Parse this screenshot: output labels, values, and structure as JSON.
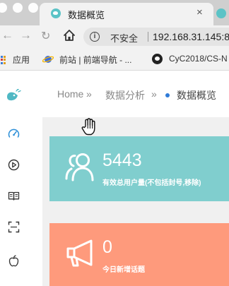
{
  "browser": {
    "tab": {
      "title": "数据概览",
      "close_glyph": "×"
    },
    "toolbar": {
      "back_glyph": "←",
      "forward_glyph": "→",
      "reload_glyph": "↻",
      "security_label": "不安全",
      "url": "192.168.31.145:8"
    },
    "bookmarks": [
      {
        "label": "应用",
        "icon": "apps-grid-icon"
      },
      {
        "label": "前站 | 前端导航 - ...",
        "icon": "planet-icon"
      },
      {
        "label": "CyC2018/CS-N",
        "icon": "github-icon"
      }
    ]
  },
  "sidebar": {
    "logo": "bird-logo-icon",
    "items": [
      {
        "icon": "dashboard-gauge-icon"
      },
      {
        "icon": "play-circle-icon"
      },
      {
        "icon": "book-open-icon"
      },
      {
        "icon": "scan-frame-icon"
      },
      {
        "icon": "apple-icon"
      }
    ]
  },
  "breadcrumb": {
    "home": "Home",
    "separator": "»",
    "section": "数据分析",
    "current": "数据概览"
  },
  "cards": {
    "users": {
      "value": "5443",
      "label": "有效总用户量(不包括封号,移除)",
      "color": "#80cece",
      "icon": "users-icon"
    },
    "topics": {
      "value": "0",
      "label": "今日新增话题",
      "color": "#fe9a7c",
      "icon": "megaphone-icon"
    }
  }
}
